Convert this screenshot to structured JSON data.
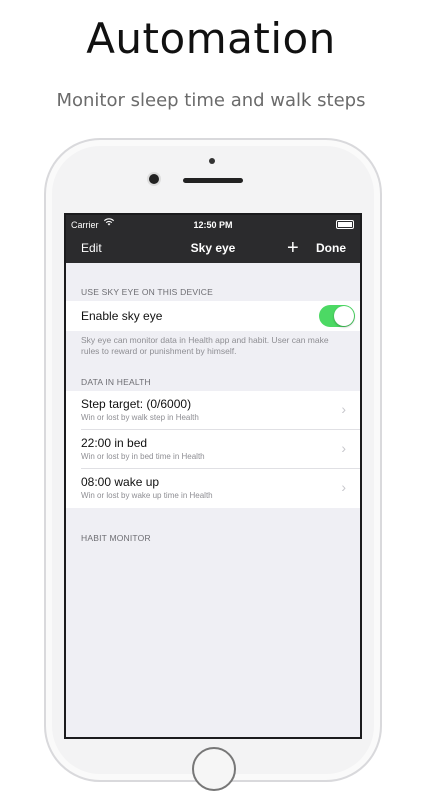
{
  "promo": {
    "headline": "Automation",
    "subline": "Monitor sleep time and walk steps"
  },
  "status_bar": {
    "carrier": "Carrier",
    "wifi_icon": "wifi-icon",
    "time": "12:50 PM",
    "battery_icon": "battery-icon"
  },
  "nav": {
    "left": "Edit",
    "title": "Sky eye",
    "add": "+",
    "done": "Done"
  },
  "sections": {
    "device": {
      "header": "USE SKY EYE ON THIS DEVICE",
      "toggle_label": "Enable sky eye",
      "toggle_on": true,
      "toggle_color": "#4cd964",
      "footer": "Sky eye can monitor data in Health app and habit. User can make rules to reward or punishment by himself."
    },
    "health": {
      "header": "DATA IN HEALTH",
      "rows": [
        {
          "title": "Step target: (0/6000)",
          "subtitle": "Win or lost by walk step in Health"
        },
        {
          "title": "22:00 in bed",
          "subtitle": "Win or lost by in bed time in Health"
        },
        {
          "title": "08:00 wake up",
          "subtitle": "Win or lost by wake up time in Health"
        }
      ]
    },
    "habit": {
      "header": "HABIT MONITOR"
    }
  }
}
